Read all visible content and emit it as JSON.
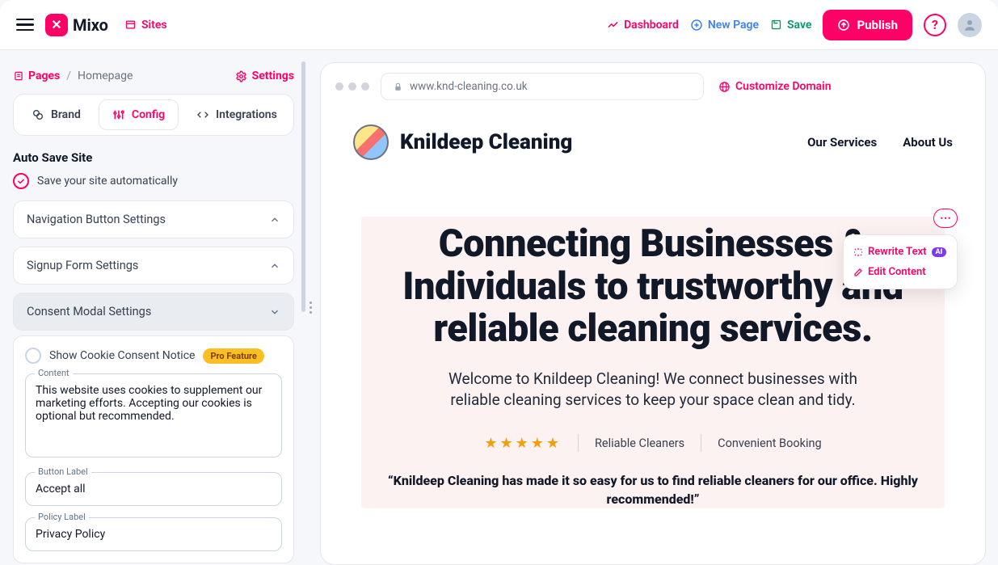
{
  "topbar": {
    "brand": "Mixo",
    "sites": "Sites",
    "dashboard": "Dashboard",
    "newpage": "New Page",
    "save": "Save",
    "publish": "Publish"
  },
  "left": {
    "pages": "Pages",
    "crumb_sep": "/",
    "crumb_current": "Homepage",
    "settings": "Settings",
    "tabs": {
      "brand": "Brand",
      "config": "Config",
      "integrations": "Integrations"
    },
    "autosave_title": "Auto Save Site",
    "autosave_label": "Save your site automatically",
    "acc1": "Navigation Button Settings",
    "acc2": "Signup Form Settings",
    "acc3": "Consent Modal Settings",
    "consent": {
      "show_label": "Show Cookie Consent Notice",
      "pro": "Pro Feature",
      "content_label": "Content",
      "content_value": "This website uses cookies to supplement our marketing efforts. Accepting our cookies is optional but recommended.",
      "button_label_label": "Button Label",
      "button_label_value": "Accept all",
      "policy_label_label": "Policy Label",
      "policy_label_value": "Privacy Policy"
    }
  },
  "browser": {
    "url": "www.knd-cleaning.co.uk",
    "customize": "Customize Domain"
  },
  "site": {
    "brand": "Knildeep Cleaning",
    "nav1": "Our Services",
    "nav2": "About Us",
    "hero_h1": "Connecting Businesses & Individuals to trustworthy and reliable cleaning services.",
    "hero_p": "Welcome to Knildeep Cleaning! We connect businesses with reliable cleaning services to keep your space clean and tidy.",
    "review1": "Reliable Cleaners",
    "review2": "Convenient Booking",
    "quote": "“Knildeep Cleaning has made it so easy for us to find reliable cleaners for our office. Highly recommended!”"
  },
  "popover": {
    "rewrite": "Rewrite Text",
    "ai": "AI",
    "edit": "Edit Content"
  }
}
